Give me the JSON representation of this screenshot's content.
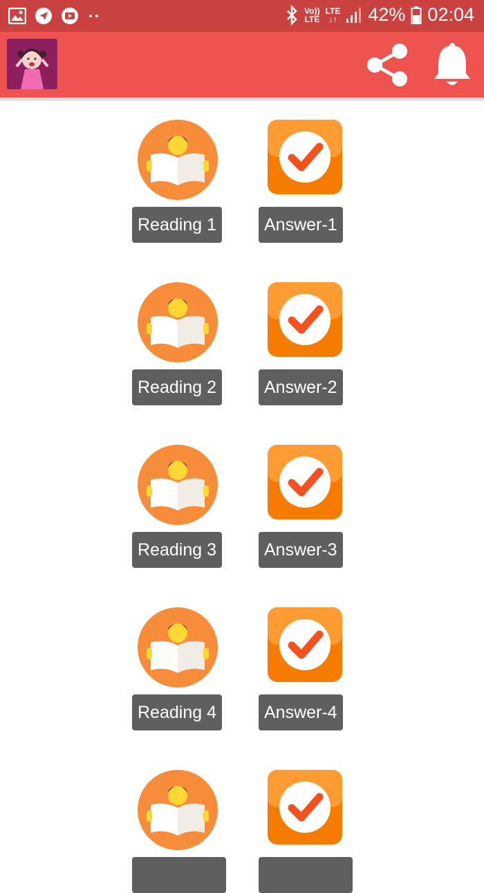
{
  "status_bar": {
    "volte_top": "Vo))",
    "volte_bottom": "LTE",
    "lte_top": "LTE",
    "lte_bottom": "↓↑",
    "battery": "42%",
    "time": "02:04",
    "icons": [
      "gallery-icon",
      "telegram-icon",
      "youtube-icon",
      "more-dots-icon",
      "bluetooth-icon",
      "signal-icon",
      "battery-icon"
    ]
  },
  "app_bar": {
    "logo": "cartoon-girl-avatar",
    "actions": [
      "share-icon",
      "bell-icon"
    ]
  },
  "colors": {
    "status_bar": "#c9423f",
    "app_bar": "#ef5350",
    "reading_circle": "#f78d3a",
    "answer_square": "#f57c00",
    "label_bg": "#5f5f5f"
  },
  "items": [
    {
      "reading": "Reading 1",
      "answer": "Answer-1"
    },
    {
      "reading": "Reading 2",
      "answer": "Answer-2"
    },
    {
      "reading": "Reading 3",
      "answer": "Answer-3"
    },
    {
      "reading": "Reading 4",
      "answer": "Answer-4"
    },
    {
      "reading": "",
      "answer": ""
    }
  ]
}
